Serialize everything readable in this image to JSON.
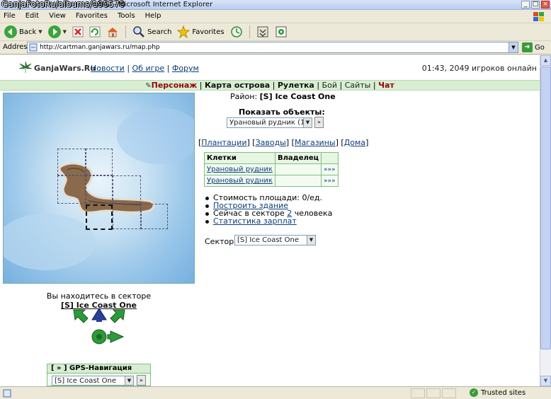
{
  "window": {
    "watermark": "GanjaFotoRu/albums/195579",
    "title": "ойны - Microsoft Internet Explorer",
    "buttons": [
      "_",
      "□",
      "×"
    ]
  },
  "menubar": [
    "File",
    "Edit",
    "View",
    "Favorites",
    "Tools",
    "Help"
  ],
  "toolbar": {
    "back": "Back",
    "search": "Search",
    "favorites": "Favorites",
    "icons": [
      "back-icon",
      "forward-icon",
      "stop-icon",
      "refresh-icon",
      "home-icon",
      "search-icon",
      "favorites-star-icon",
      "history-icon",
      "mail-icon",
      "print-icon"
    ]
  },
  "address": {
    "label": "Address",
    "url": "http://cartman.ganjawars.ru/map.php",
    "go": "Go"
  },
  "site": {
    "name": "GanjaWars.Ru",
    "sep": ":",
    "links": [
      "Новости",
      "Об игре",
      "Форум"
    ],
    "online": "01:43, 2049 игроков онлайн"
  },
  "nav": {
    "items": [
      {
        "label": "Персонаж",
        "style": "red"
      },
      {
        "label": "Карта острова",
        "style": "bold"
      },
      {
        "label": "Рулетка",
        "style": "bold"
      },
      {
        "label": "Бой",
        "style": "normal"
      },
      {
        "label": "Сайты",
        "style": "normal"
      },
      {
        "label": "Чат",
        "style": "red"
      }
    ]
  },
  "district": {
    "label": "Район:",
    "value": "[S] Ice Coast One"
  },
  "show_objects": {
    "label": "Показать объекты:",
    "selected": "Урановый рудник (1)",
    "go": "»"
  },
  "filters": {
    "items": [
      "Плантации",
      "Заводы",
      "Магазины",
      "Дома"
    ]
  },
  "table": {
    "headers": [
      "Клетки",
      "Владелец",
      ""
    ],
    "rows": [
      {
        "cell": "Урановый рудник",
        "owner": "",
        "go": "»»»"
      },
      {
        "cell": "Урановый рудник",
        "owner": "",
        "go": "»»»"
      }
    ]
  },
  "info": {
    "cost": "Стоимость площади: 0/ед.",
    "build": "Построить здание",
    "now_prefix": "Сейчас в секторе",
    "now_count": "2",
    "now_suffix": "человека",
    "salary": "Статистика зарплат"
  },
  "sector": {
    "label": "Сектор:",
    "selected": "[S] Ice Coast One"
  },
  "location": {
    "text": "Вы находитесь в секторе",
    "sector": "[S] Ice Coast One"
  },
  "gps": {
    "header": "[ » ] GPS-Навигация",
    "selected": "[S] Ice Coast One",
    "go": "»"
  },
  "statusbar": {
    "zone": "Trusted sites"
  },
  "colors": {
    "nav_bg": "#d7eed3",
    "link": "#0b3e7a",
    "accent_red": "#990000"
  }
}
